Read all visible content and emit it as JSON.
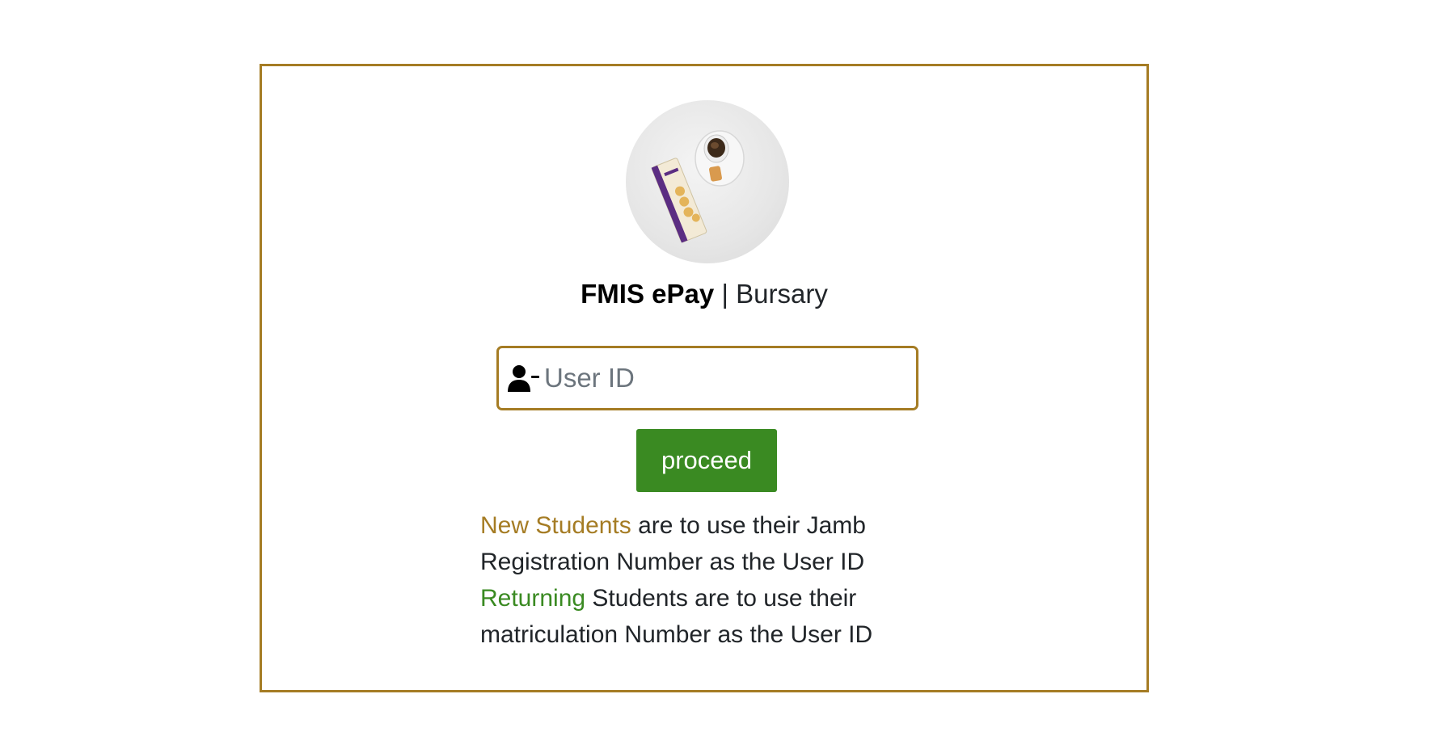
{
  "header": {
    "brand": "FMIS ePay",
    "separator": " | ",
    "section": "Bursary"
  },
  "login": {
    "user_id_placeholder": "User ID",
    "user_id_value": "",
    "proceed_label": "proceed"
  },
  "notes": {
    "new_students_highlight": "New Students",
    "new_students_text": " are to use their Jamb Registration Number as the User ID",
    "returning_highlight": "Returning",
    "returning_text": " Students are to use their matriculation Number as the User ID"
  },
  "icons": {
    "input_icon": "user-minus-icon",
    "avatar": "product-photo-avatar"
  },
  "colors": {
    "accent_gold": "#a57c24",
    "button_green": "#3a8a22",
    "text": "#212529"
  }
}
